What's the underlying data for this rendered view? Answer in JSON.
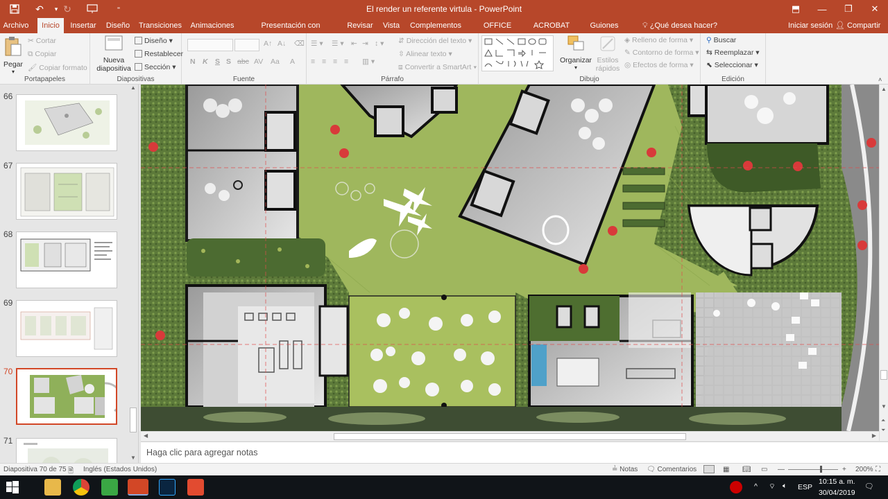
{
  "window": {
    "title": "El render un referente virtula - PowerPoint",
    "controls": [
      "⬒",
      "—",
      "❐",
      "✕"
    ]
  },
  "tabs": [
    {
      "label": "Archivo"
    },
    {
      "label": "Inicio"
    },
    {
      "label": "Insertar"
    },
    {
      "label": "Diseño"
    },
    {
      "label": "Transiciones"
    },
    {
      "label": "Animaciones"
    },
    {
      "label": "Presentación con diapositivas"
    },
    {
      "label": "Revisar"
    },
    {
      "label": "Vista"
    },
    {
      "label": "Complementos"
    },
    {
      "label": "OFFICE REMOTE"
    },
    {
      "label": "ACROBAT"
    },
    {
      "label": "Guiones gráficos"
    }
  ],
  "tell_me": "¿Qué desea hacer?",
  "signin": "Iniciar sesión",
  "share": "Compartir",
  "ribbon": {
    "portapapeles": {
      "label": "Portapapeles",
      "pegar": "Pegar",
      "cortar": "Cortar",
      "copiar": "Copiar",
      "copiar_formato": "Copiar formato"
    },
    "diapositivas": {
      "label": "Diapositivas",
      "nueva1": "Nueva",
      "nueva2": "diapositiva",
      "diseno": "Diseño",
      "restablecer": "Restablecer",
      "seccion": "Sección"
    },
    "fuente": {
      "label": "Fuente",
      "bold": "N",
      "italic": "K",
      "underline": "S",
      "strike": "S",
      "abc": "abc"
    },
    "parrafo": {
      "label": "Párrafo",
      "direccion": "Dirección del texto",
      "alinear": "Alinear texto",
      "smartart": "Convertir a SmartArt"
    },
    "dibujo": {
      "label": "Dibujo",
      "organizar": "Organizar",
      "estilos1": "Estilos",
      "estilos2": "rápidos",
      "relleno": "Relleno de forma",
      "contorno": "Contorno de forma",
      "efectos": "Efectos de forma"
    },
    "edicion": {
      "label": "Edición",
      "buscar": "Buscar",
      "reemplazar": "Reemplazar",
      "seleccionar": "Seleccionar"
    }
  },
  "slides": [
    {
      "num": "66"
    },
    {
      "num": "67"
    },
    {
      "num": "68"
    },
    {
      "num": "69"
    },
    {
      "num": "70"
    },
    {
      "num": "71"
    }
  ],
  "notes_placeholder": "Haga clic para agregar notas",
  "status": {
    "slide_info": "Diapositiva 70 de 75",
    "language": "Inglés (Estados Unidos)",
    "notas": "Notas",
    "comentarios": "Comentarios",
    "zoom": "200%"
  },
  "taskbar": {
    "lang": "ESP",
    "time": "10:15 a. m.",
    "date": "30/04/2019"
  },
  "colors": {
    "accent": "#b7472a",
    "selected": "#d24726"
  }
}
